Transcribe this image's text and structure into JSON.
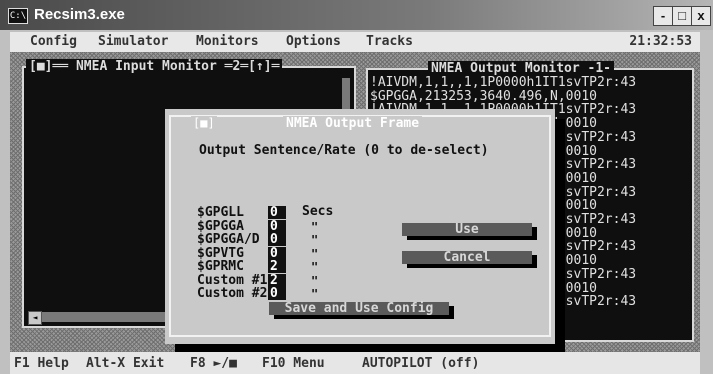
{
  "window": {
    "title": "Recsim3.exe",
    "app_icon": "C:\\",
    "minimize": "-",
    "maximize": "□",
    "close": "x"
  },
  "menubar": {
    "items": [
      "Config",
      "Simulator",
      "Monitors",
      "Options",
      "Tracks"
    ],
    "clock": "21:32:53"
  },
  "input_monitor": {
    "title": "[■]══ NMEA Input Monitor ═2═[↑]═"
  },
  "output_monitor": {
    "title": "NMEA Output Monitor -1-",
    "lines": [
      "!AIVDM,1,1,,1,1P0000h1IT1svTP2r:43",
      "$GPGGA,213253,3640.496,N,0010",
      "!AIVDM,1,1,,1,1P0000h1IT1svTP2r:43",
      "$GPGGA,213252,3640.489,N,0010",
      "!AIVDM,1,1,,1,1P0000h1IT1svTP2r:43",
      "$GPGGA,213251,3640.505,N,0010",
      "!AIVDM,1,1,,1,1P0000h1IT1svTP2r:43",
      "$GPGGA,213250,3640.515,N,0010",
      "!AIVDM,1,1,,1,1P0000h1IT1svTP2r:43",
      "$GPGGA,213249,3640.501,N,0010",
      "!AIVDM,1,1,,1,1P0000h1IT1svTP2r:43",
      "$GPGGA,213248,3640.510,N,0010",
      "!AIVDM,1,1,,1,1P0000h1IT1svTP2r:43",
      "$GPGGA,213247,3640.495,N,0010",
      "!AIVDM,1,1,,1,1P0000h1IT1svTP2r:43",
      "$GPGGA,213246,3640.500,N,0010",
      "!AIVDM,1,1,,1,1P0000h1IT1svTP2r:43"
    ]
  },
  "dialog": {
    "close": "[■]",
    "title": "NMEA Output Frame",
    "heading": "Output Sentence/Rate (0 to de-select)",
    "units": "Secs",
    "ditto": "\"",
    "sentences": [
      {
        "label": "$GPGLL",
        "value": "0"
      },
      {
        "label": "$GPGGA",
        "value": "0"
      },
      {
        "label": "$GPGGA/D",
        "value": "0"
      },
      {
        "label": "$GPVTG",
        "value": "0"
      },
      {
        "label": "$GPRMC",
        "value": "2"
      },
      {
        "label": "Custom #1",
        "value": "2"
      },
      {
        "label": "Custom #2",
        "value": "0"
      }
    ],
    "use_button": "Use",
    "cancel_button": "Cancel",
    "save_button": "Save and Use Config"
  },
  "statusbar": {
    "items": [
      "F1 Help",
      "Alt-X Exit",
      "F8 ►/■",
      "F10 Menu",
      "AUTOPILOT (off)"
    ]
  }
}
